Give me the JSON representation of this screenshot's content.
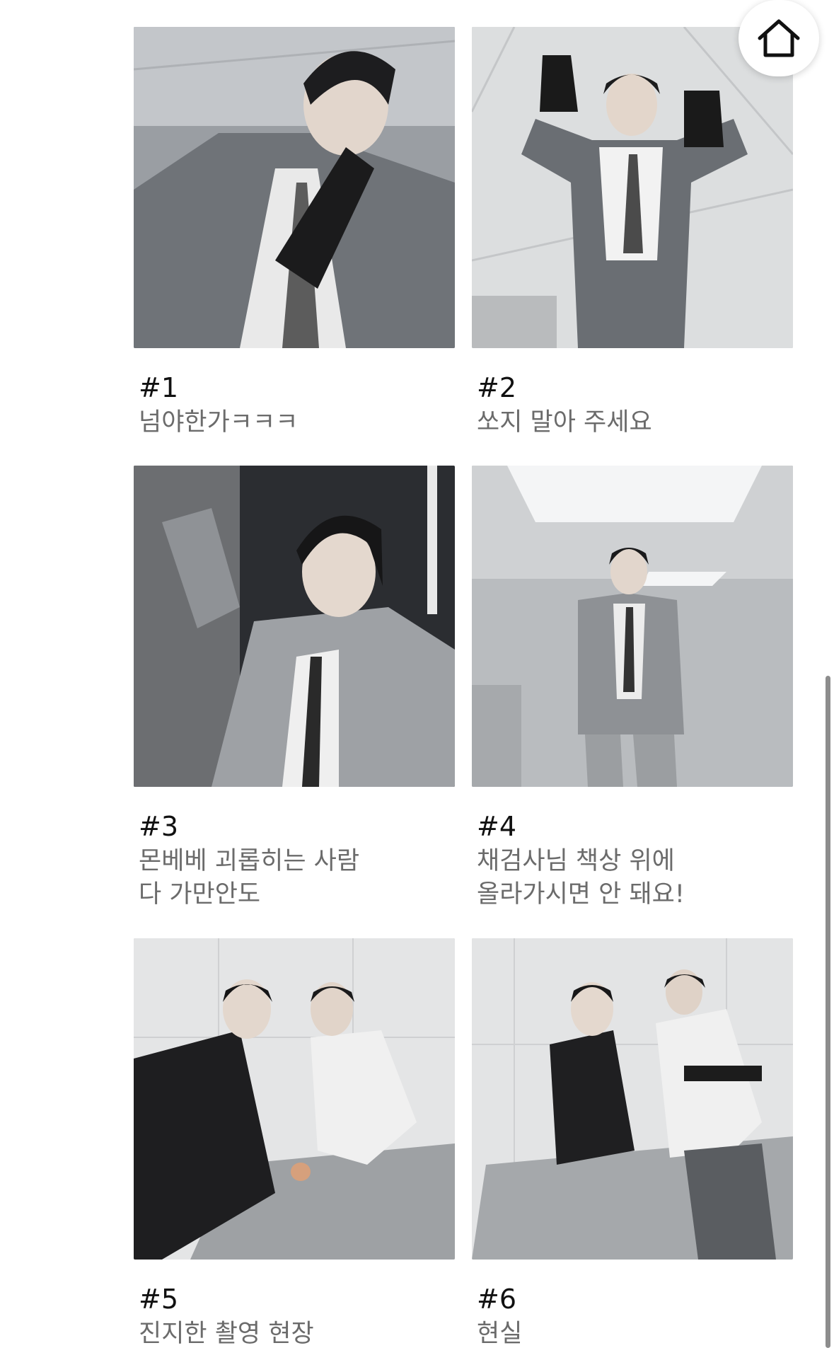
{
  "home_button": {
    "icon": "home-icon"
  },
  "posts": [
    {
      "number": "#1",
      "caption_lines": [
        "넘야한가ㅋㅋㅋ"
      ]
    },
    {
      "number": "#2",
      "caption_lines": [
        "쏘지 말아 주세요"
      ]
    },
    {
      "number": "#3",
      "caption_lines": [
        "몬베베 괴롭히는 사람",
        "다 가만안도"
      ]
    },
    {
      "number": "#4",
      "caption_lines": [
        "채검사님 책상 위에",
        "올라가시면 안 돼요!"
      ]
    },
    {
      "number": "#5",
      "caption_lines": [
        "진지한 촬영 현장"
      ]
    },
    {
      "number": "#6",
      "caption_lines": [
        "현실"
      ]
    }
  ]
}
